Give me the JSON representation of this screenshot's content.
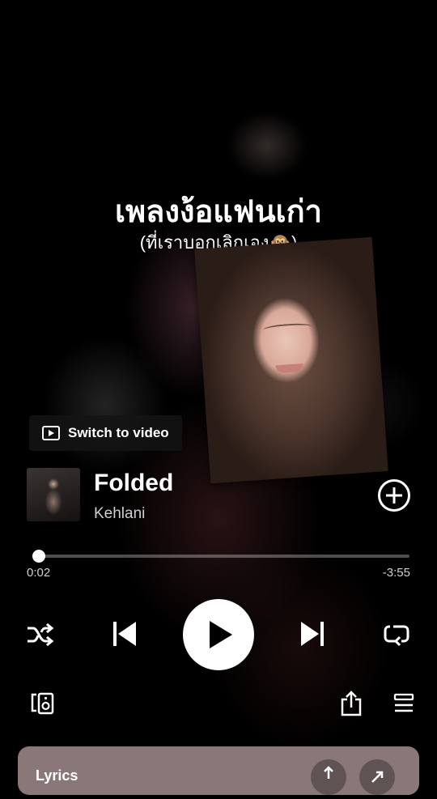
{
  "overlay": {
    "title": "เพลงง้อแฟนเก่า",
    "subtitle": "(ที่เราบอกเลิกเอง🙊)"
  },
  "switch_video": {
    "label": "Switch to video",
    "icon": "video-icon"
  },
  "track": {
    "title": "Folded",
    "artist": "Kehlani"
  },
  "progress": {
    "elapsed": "0:02",
    "remaining": "-3:55",
    "fraction": 0.01
  },
  "controls": {
    "shuffle_icon": "shuffle-icon",
    "previous_icon": "skip-previous-icon",
    "play_icon": "play-icon",
    "next_icon": "skip-next-icon",
    "repeat_icon": "repeat-icon",
    "devices_icon": "connect-device-icon",
    "share_icon": "share-icon",
    "queue_icon": "queue-icon",
    "add_icon": "add-circle-icon"
  },
  "lyrics": {
    "label": "Lyrics"
  },
  "colors": {
    "background": "#000000",
    "lyrics_card": "#8a7878",
    "foreground": "#ffffff"
  }
}
